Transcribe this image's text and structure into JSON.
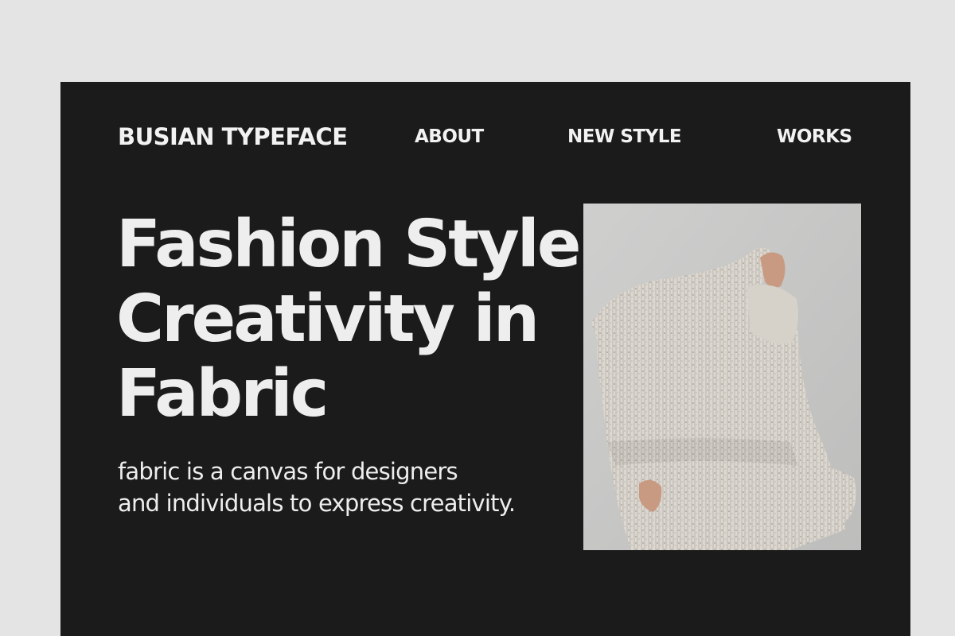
{
  "nav": {
    "brand": "BUSIAN TYPEFACE",
    "links": [
      {
        "label": "ABOUT"
      },
      {
        "label": "NEW STYLE"
      },
      {
        "label": "WORKS"
      }
    ]
  },
  "hero": {
    "headline_lines": [
      "Fashion Style",
      "Creativity in",
      "Fabric"
    ],
    "tagline_lines": [
      "fabric is a canvas for designers",
      "and individuals to express creativity."
    ]
  },
  "colors": {
    "page_background": "#e4e4e4",
    "panel_background": "#1b1b1b",
    "text": "#eeeeee",
    "photo_background": "#c9c9c8",
    "sweater": "#dcd8d1"
  }
}
